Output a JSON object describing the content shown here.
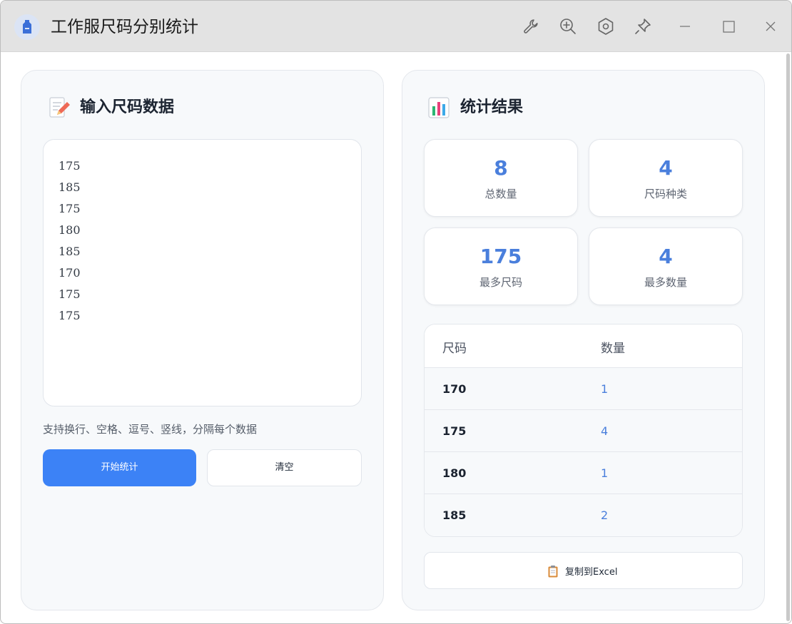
{
  "window": {
    "title": "工作服尺码分别统计",
    "toolbar_icons": [
      "wrench-icon",
      "zoom-in-icon",
      "settings-hex-icon",
      "pin-icon",
      "minimize-icon",
      "maximize-icon",
      "close-icon"
    ]
  },
  "input_panel": {
    "title": "输入尺码数据",
    "icon": "memo-icon",
    "lines": [
      "175",
      "185",
      "175",
      "180",
      "185",
      "170",
      "175",
      "175"
    ],
    "hint": "支持换行、空格、逗号、竖线，分隔每个数据",
    "start_button": "开始统计",
    "clear_button": "清空"
  },
  "result_panel": {
    "title": "统计结果",
    "icon": "bar-chart-icon",
    "stats": {
      "total": {
        "value": "8",
        "label": "总数量"
      },
      "kinds": {
        "value": "4",
        "label": "尺码种类"
      },
      "top_size": {
        "value": "175",
        "label": "最多尺码"
      },
      "top_count": {
        "value": "4",
        "label": "最多数量"
      }
    },
    "table": {
      "headers": [
        "尺码",
        "数量"
      ],
      "rows": [
        {
          "size": "170",
          "count": "1"
        },
        {
          "size": "175",
          "count": "4"
        },
        {
          "size": "180",
          "count": "1"
        },
        {
          "size": "185",
          "count": "2"
        }
      ]
    },
    "copy_button": "复制到Excel"
  },
  "colors": {
    "accent": "#3c82f6",
    "value_blue": "#4a7fdc",
    "titlebar": "#e3e3e3",
    "card_bg": "#f7f9fb"
  }
}
